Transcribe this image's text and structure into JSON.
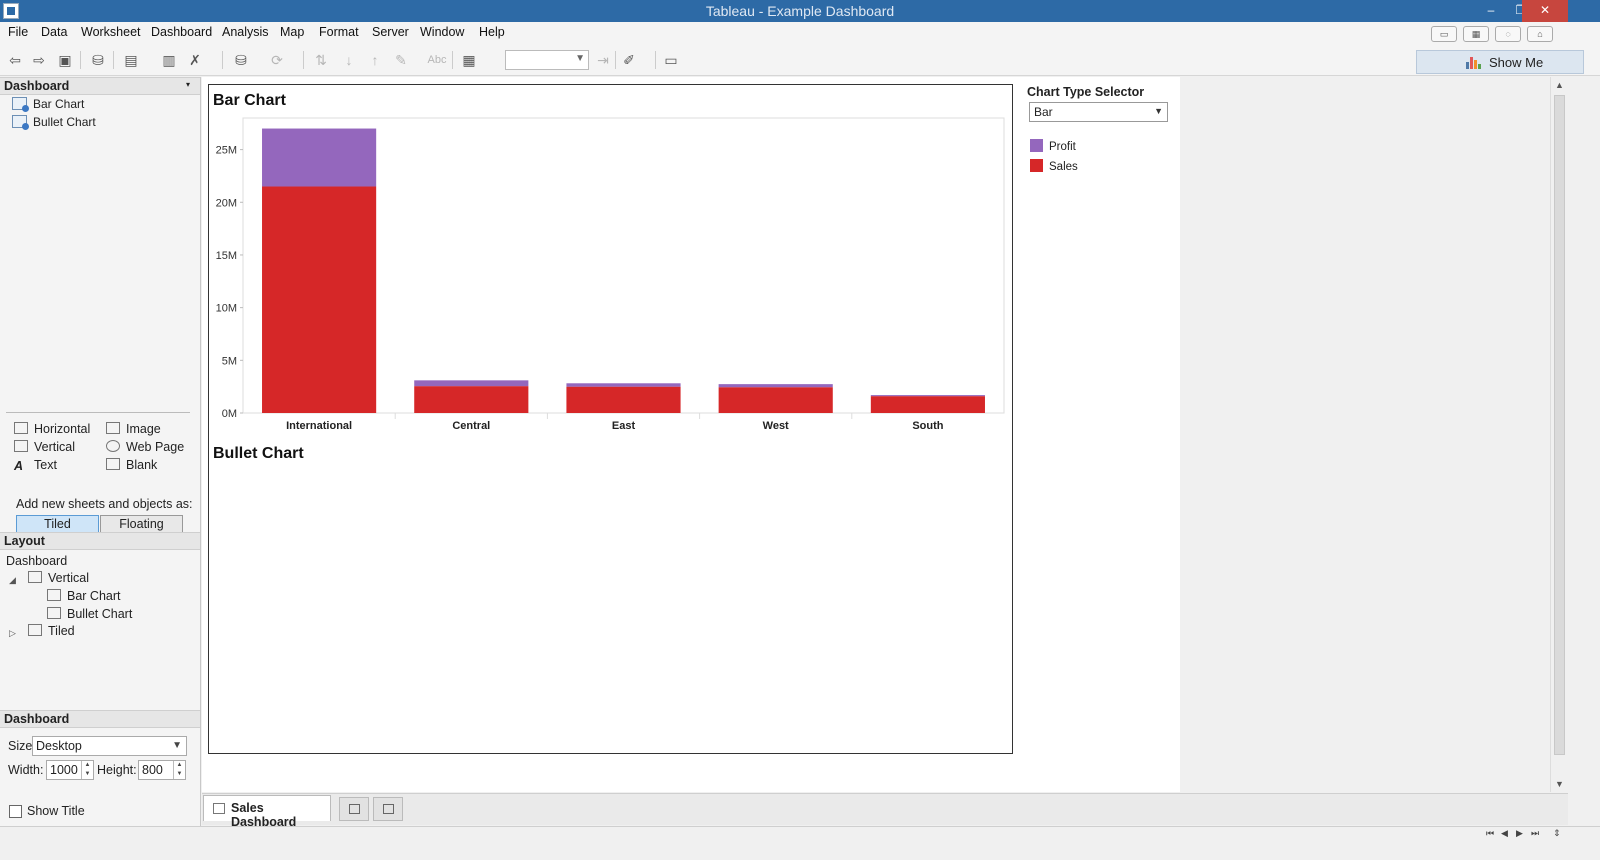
{
  "window": {
    "title": "Tableau - Example Dashboard",
    "minimize": "–",
    "restore": "❐",
    "close": "✕"
  },
  "menu": [
    "File",
    "Data",
    "Worksheet",
    "Dashboard",
    "Analysis",
    "Map",
    "Format",
    "Server",
    "Window",
    "Help"
  ],
  "toolbar": {
    "show_me_label": "Show Me",
    "accent": "#2d6aa6"
  },
  "left_panel": {
    "dashboard_header": "Dashboard",
    "sheets": [
      "Bar Chart",
      "Bullet Chart"
    ],
    "objects": [
      {
        "label": "Horizontal",
        "icon": "horizontal-container-icon"
      },
      {
        "label": "Image",
        "icon": "image-icon"
      },
      {
        "label": "Vertical",
        "icon": "vertical-container-icon"
      },
      {
        "label": "Web Page",
        "icon": "web-page-icon"
      },
      {
        "label": "Text",
        "icon": "text-icon"
      },
      {
        "label": "Blank",
        "icon": "blank-icon"
      }
    ],
    "add_new_label": "Add new sheets and objects as:",
    "tiled_label": "Tiled",
    "floating_label": "Floating",
    "layout_header": "Layout",
    "layout_tree": {
      "root": "Dashboard",
      "vertical": "Vertical",
      "children": [
        "Bar Chart",
        "Bullet Chart"
      ],
      "tiled": "Tiled"
    },
    "size_header": "Dashboard",
    "size_label": "Size:",
    "size_value": "Desktop",
    "width_label": "Width:",
    "width_value": "1000",
    "height_label": "Height:",
    "height_value": "800",
    "show_title_label": "Show Title"
  },
  "dashboard": {
    "bar_chart_title": "Bar Chart",
    "bullet_chart_title": "Bullet Chart",
    "selector_label": "Chart Type Selector",
    "selector_value": "Bar",
    "legend": [
      {
        "label": "Profit",
        "color": "#9467bd"
      },
      {
        "label": "Sales",
        "color": "#d62728"
      }
    ]
  },
  "chart_data": {
    "type": "bar",
    "stacked": true,
    "categories": [
      "International",
      "Central",
      "East",
      "West",
      "South"
    ],
    "series": [
      {
        "name": "Sales",
        "color": "#d62728",
        "values": [
          21500000,
          2550000,
          2500000,
          2450000,
          1600000
        ]
      },
      {
        "name": "Profit",
        "color": "#9467bd",
        "values": [
          5500000,
          550000,
          320000,
          290000,
          100000
        ]
      }
    ],
    "y_ticks": [
      0,
      5000000,
      10000000,
      15000000,
      20000000,
      25000000
    ],
    "y_tick_labels": [
      "0M",
      "5M",
      "10M",
      "15M",
      "20M",
      "25M"
    ],
    "ylim": [
      0,
      28000000
    ],
    "grid": false,
    "legend_position": "right"
  },
  "tabs": {
    "active": "Sales Dashboard"
  }
}
